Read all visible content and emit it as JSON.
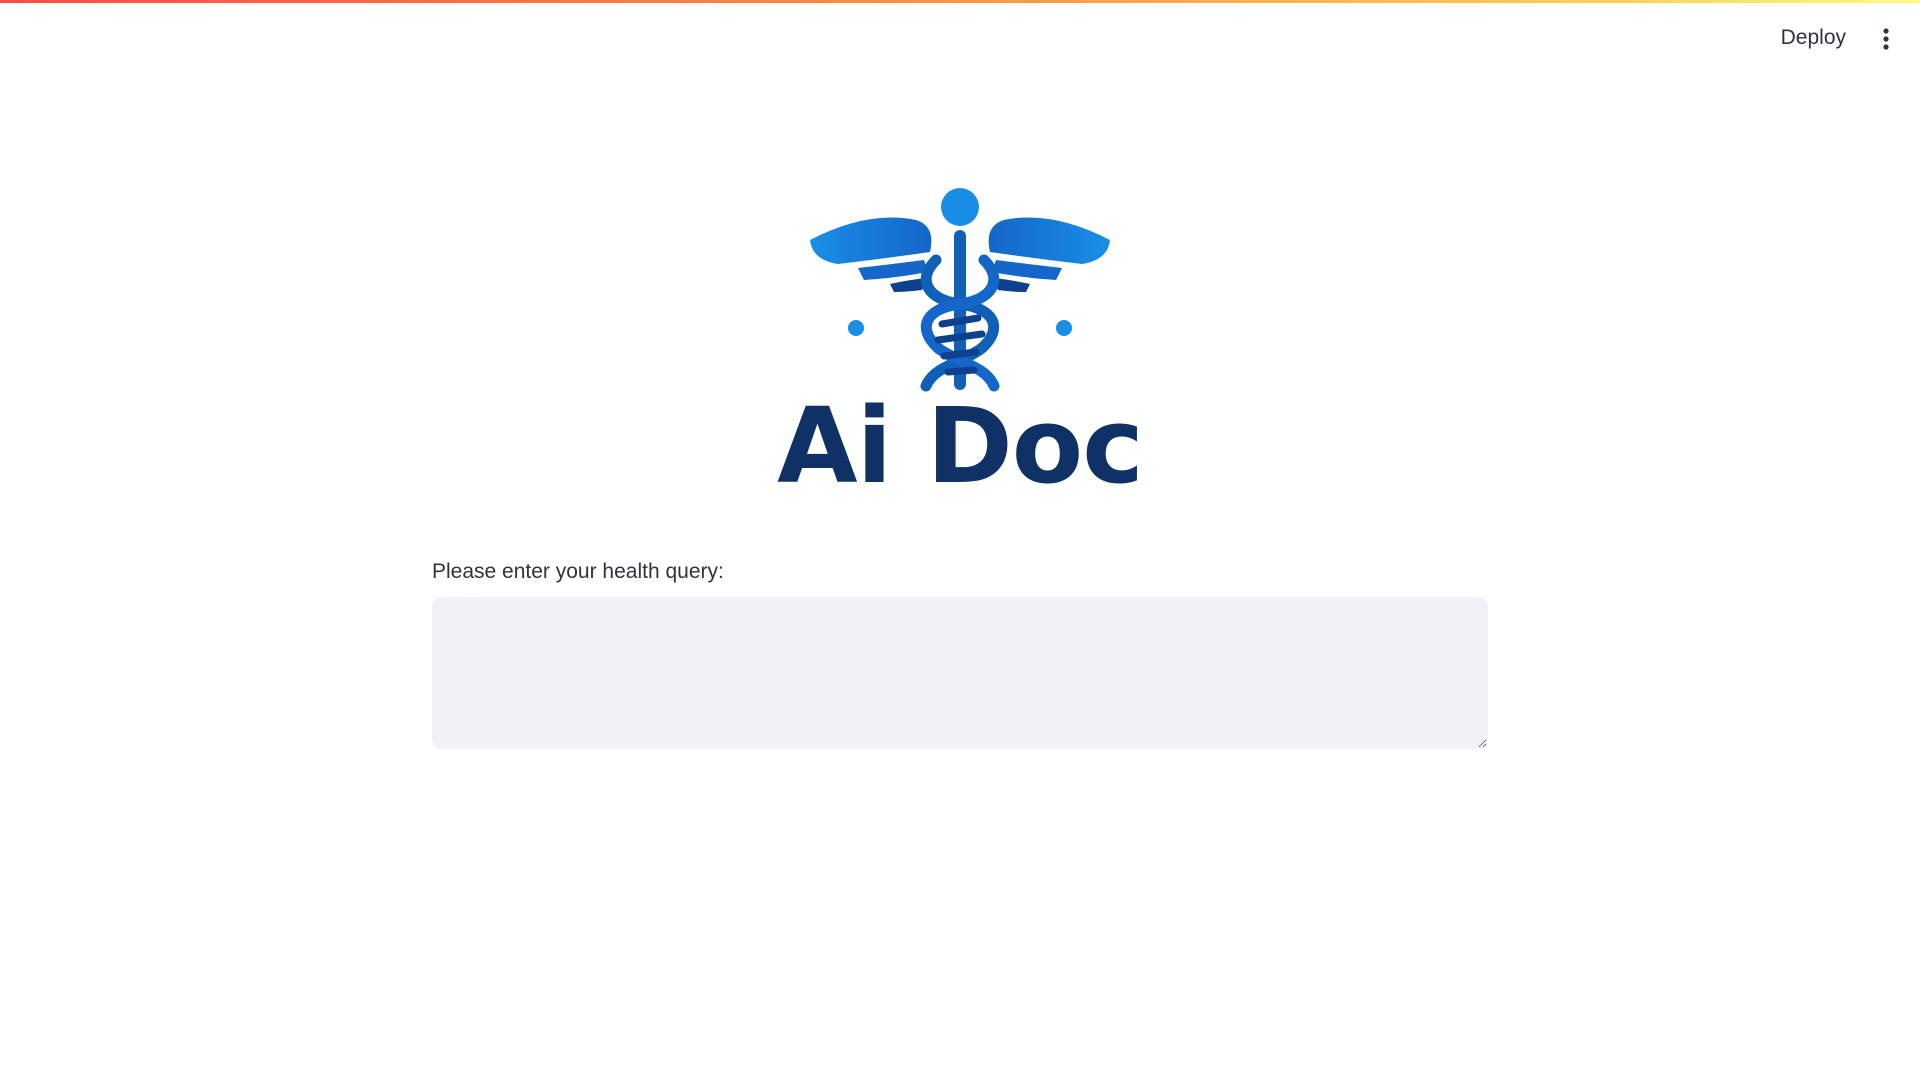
{
  "header": {
    "deploy_label": "Deploy",
    "menu_icon": "more-vertical-icon"
  },
  "logo": {
    "text": "Ai Doc",
    "icon": "caduceus-dna-icon"
  },
  "query": {
    "label": "Please enter your health query:",
    "value": "",
    "placeholder": ""
  },
  "colors": {
    "brand_dark": "#0f3166",
    "brand_blue": "#1a8ee6",
    "brand_mid": "#1060b8",
    "input_bg": "#f0f2f6",
    "text": "#31333f",
    "accent_red": "#ff4b4b",
    "accent_yellow": "#fffd80"
  }
}
